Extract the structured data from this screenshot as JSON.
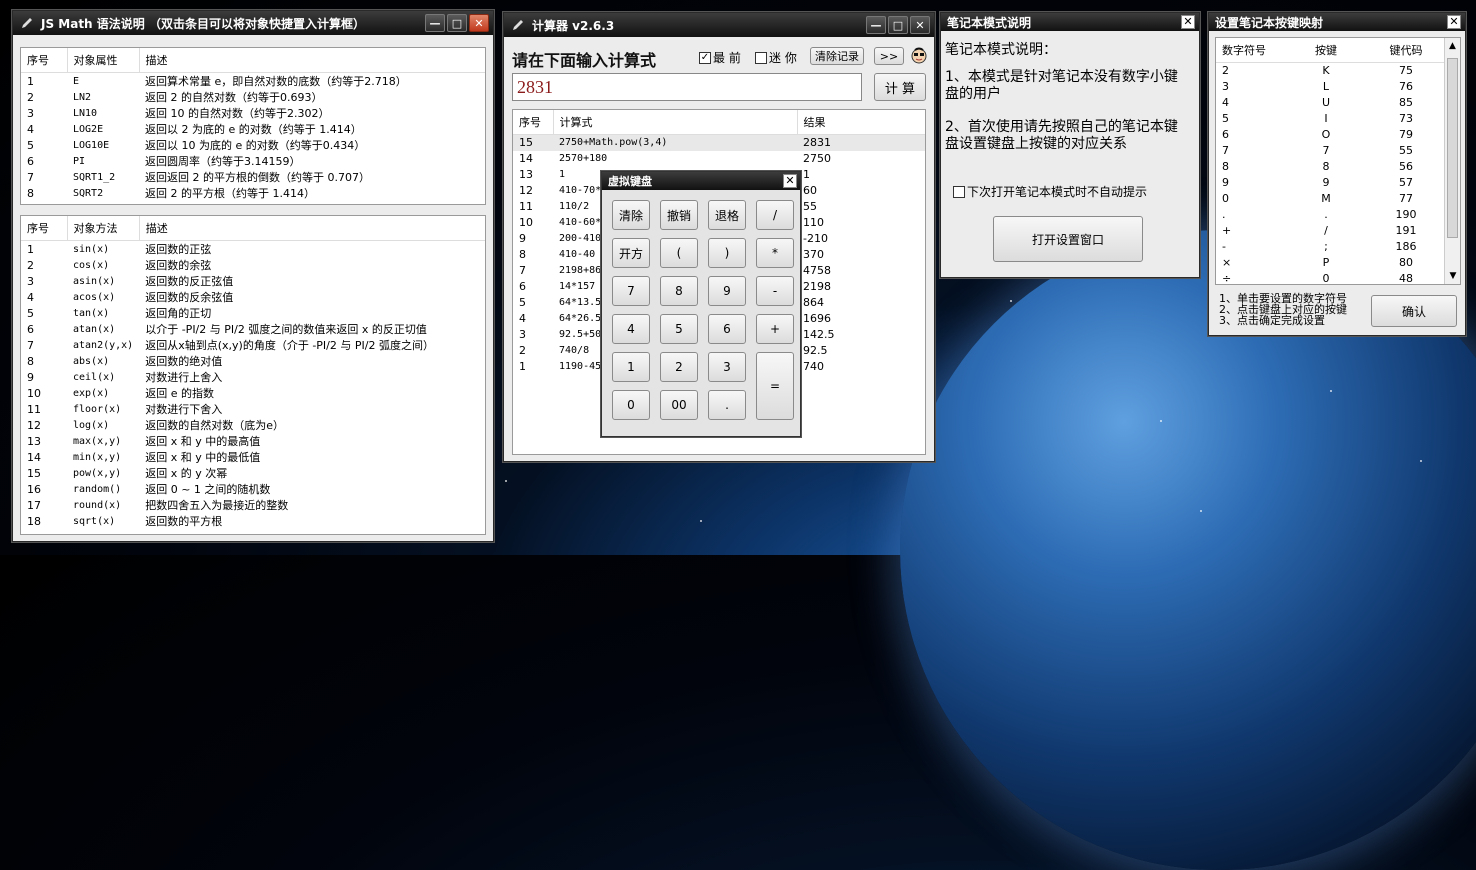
{
  "syntax_window": {
    "title": "JS Math 语法说明 （双击条目可以将对象快捷置入计算框）",
    "props_headers": [
      "序号",
      "对象属性",
      "描述"
    ],
    "props": [
      [
        "1",
        "E",
        "返回算术常量 e，即自然对数的底数（约等于2.718）"
      ],
      [
        "2",
        "LN2",
        "返回 2 的自然对数（约等于0.693）"
      ],
      [
        "3",
        "LN10",
        "返回 10 的自然对数（约等于2.302）"
      ],
      [
        "4",
        "LOG2E",
        "返回以 2 为底的 e 的对数（约等于 1.414）"
      ],
      [
        "5",
        "LOG10E",
        "返回以 10 为底的 e 的对数（约等于0.434）"
      ],
      [
        "6",
        "PI",
        "返回圆周率（约等于3.14159）"
      ],
      [
        "7",
        "SQRT1_2",
        "返回返回 2 的平方根的倒数（约等于 0.707）"
      ],
      [
        "8",
        "SQRT2",
        "返回 2 的平方根（约等于 1.414）"
      ]
    ],
    "methods_headers": [
      "序号",
      "对象方法",
      "描述"
    ],
    "methods": [
      [
        "1",
        "sin(x)",
        "返回数的正弦"
      ],
      [
        "2",
        "cos(x)",
        "返回数的余弦"
      ],
      [
        "3",
        "asin(x)",
        "返回数的反正弦值"
      ],
      [
        "4",
        "acos(x)",
        "返回数的反余弦值"
      ],
      [
        "5",
        "tan(x)",
        "返回角的正切"
      ],
      [
        "6",
        "atan(x)",
        "以介于 -PI/2 与 PI/2 弧度之间的数值来返回 x 的反正切值"
      ],
      [
        "7",
        "atan2(y,x)",
        "返回从x轴到点(x,y)的角度（介于 -PI/2 与 PI/2 弧度之间）"
      ],
      [
        "8",
        "abs(x)",
        "返回数的绝对值"
      ],
      [
        "9",
        "ceil(x)",
        "对数进行上舍入"
      ],
      [
        "10",
        "exp(x)",
        "返回 e 的指数"
      ],
      [
        "11",
        "floor(x)",
        "对数进行下舍入"
      ],
      [
        "12",
        "log(x)",
        "返回数的自然对数（底为e）"
      ],
      [
        "13",
        "max(x,y)",
        "返回 x 和 y 中的最高值"
      ],
      [
        "14",
        "min(x,y)",
        "返回 x 和 y 中的最低值"
      ],
      [
        "15",
        "pow(x,y)",
        "返回 x 的 y 次幂"
      ],
      [
        "16",
        "random()",
        "返回 0 ~ 1 之间的随机数"
      ],
      [
        "17",
        "round(x)",
        "把数四舍五入为最接近的整数"
      ],
      [
        "18",
        "sqrt(x)",
        "返回数的平方根"
      ]
    ]
  },
  "calc_window": {
    "title": "计算器 v2.6.3",
    "prompt": "请在下面输入计算式",
    "checkbox_topmost": "最 前",
    "checkbox_mini": "迷 你",
    "clear_history": "清除记录",
    "expand": ">>",
    "input_value": "2831",
    "calc_button": "计 算",
    "history_headers": [
      "序号",
      "计算式",
      "结果"
    ],
    "history": [
      [
        "15",
        "2750+Math.pow(3,4)",
        "2831"
      ],
      [
        "14",
        "2570+180",
        "2750"
      ],
      [
        "13",
        "1",
        "1"
      ],
      [
        "12",
        "410-70*",
        "60"
      ],
      [
        "11",
        "110/2",
        "55"
      ],
      [
        "10",
        "410-60*",
        "110"
      ],
      [
        "9",
        "200-410",
        "-210"
      ],
      [
        "8",
        "410-40",
        "370"
      ],
      [
        "7",
        "2198+86",
        "4758"
      ],
      [
        "6",
        "14*157",
        "2198"
      ],
      [
        "5",
        "64*13.5",
        "864"
      ],
      [
        "4",
        "64*26.5",
        "1696"
      ],
      [
        "3",
        "92.5+50",
        "142.5"
      ],
      [
        "2",
        "740/8",
        "92.5"
      ],
      [
        "1",
        "1190-450",
        "740"
      ]
    ]
  },
  "vkeyboard": {
    "title": "虚拟键盘",
    "keys": [
      "清除",
      "撤销",
      "退格",
      "/",
      "开方",
      "(",
      ")",
      "*",
      "7",
      "8",
      "9",
      "-",
      "4",
      "5",
      "6",
      "+",
      "1",
      "2",
      "3",
      "=",
      "0",
      "00",
      "."
    ]
  },
  "notebook_window": {
    "title": "笔记本模式说明",
    "heading": "笔记本模式说明：",
    "item1": "1、本模式是针对笔记本没有数字小键盘的用户",
    "item2": "2、首次使用请先按照自己的笔记本键盘设置键盘上按键的对应关系",
    "checkbox": "下次打开笔记本模式时不自动提示",
    "open_button": "打开设置窗口"
  },
  "keymap_window": {
    "title": "设置笔记本按键映射",
    "headers": [
      "数字符号",
      "按键",
      "键代码"
    ],
    "rows": [
      [
        "2",
        "K",
        "75"
      ],
      [
        "3",
        "L",
        "76"
      ],
      [
        "4",
        "U",
        "85"
      ],
      [
        "5",
        "I",
        "73"
      ],
      [
        "6",
        "O",
        "79"
      ],
      [
        "7",
        "7",
        "55"
      ],
      [
        "8",
        "8",
        "56"
      ],
      [
        "9",
        "9",
        "57"
      ],
      [
        "0",
        "M",
        "77"
      ],
      [
        ".",
        ".",
        "190"
      ],
      [
        "+",
        "/",
        "191"
      ],
      [
        "-",
        ";",
        "186"
      ],
      [
        "×",
        "P",
        "80"
      ],
      [
        "÷",
        "0",
        "48"
      ]
    ],
    "hint1": "1、单击要设置的数字符号",
    "hint2": "2、点击键盘上对应的按键",
    "hint3": "3、点击确定完成设置",
    "confirm": "确认"
  }
}
